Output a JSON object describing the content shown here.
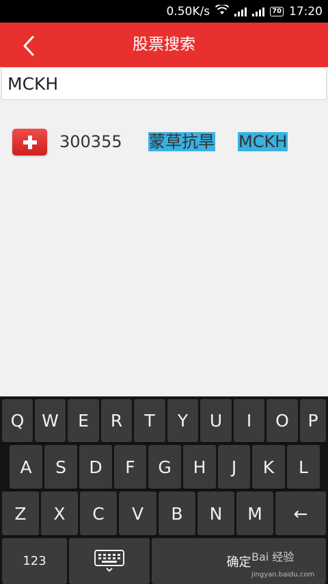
{
  "status_bar": {
    "speed": "0.50K/s",
    "battery": "70",
    "time": "17:20"
  },
  "app_bar": {
    "title": "股票搜索",
    "back_icon": "chevron-left-icon"
  },
  "search": {
    "value": "MCKH"
  },
  "results": [
    {
      "code": "300355",
      "name": "蒙草抗旱",
      "abbr": "MCKH",
      "add_icon": "plus-icon"
    }
  ],
  "keyboard": {
    "row1": [
      "Q",
      "W",
      "E",
      "R",
      "T",
      "Y",
      "U",
      "I",
      "O",
      "P"
    ],
    "row2": [
      "A",
      "S",
      "D",
      "F",
      "G",
      "H",
      "J",
      "K",
      "L"
    ],
    "row3": [
      "Z",
      "X",
      "C",
      "V",
      "B",
      "N",
      "M"
    ],
    "backspace": "←",
    "numbers": "123",
    "ime_icon": "keyboard-icon",
    "action": "确定"
  },
  "watermark": {
    "text": "Bai 经验",
    "url": "jingyan.baidu.com"
  },
  "colors": {
    "accent": "#e8312f",
    "highlight": "#39b1e1",
    "keyboard_bg": "#141414",
    "key_bg": "#3b3b3b"
  }
}
